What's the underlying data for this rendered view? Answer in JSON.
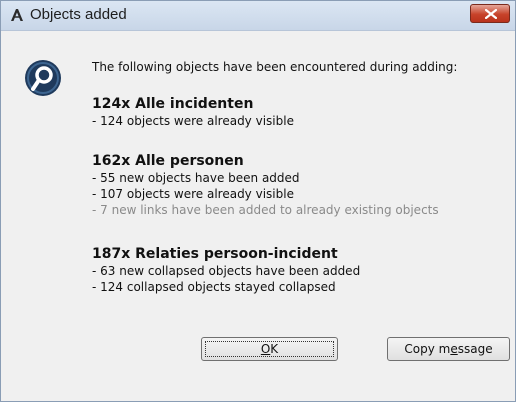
{
  "window": {
    "title": "Objects added"
  },
  "dialog": {
    "intro": "The following objects have been encountered during adding:",
    "groups": [
      {
        "title": "124x Alle incidenten",
        "lines": [
          {
            "text": "- 124 objects were already visible",
            "dim": false
          }
        ]
      },
      {
        "title": "162x Alle personen",
        "lines": [
          {
            "text": "- 55 new objects have been added",
            "dim": false
          },
          {
            "text": "- 107 objects were already visible",
            "dim": false
          },
          {
            "text": "- 7 new links have been added to already existing objects",
            "dim": true
          }
        ]
      },
      {
        "title": "187x Relaties persoon-incident",
        "lines": [
          {
            "text": "- 63 new collapsed objects have been added",
            "dim": false
          },
          {
            "text": "- 124 collapsed objects stayed collapsed",
            "dim": false
          }
        ]
      }
    ]
  },
  "buttons": {
    "ok": {
      "before": "",
      "mnemonic": "O",
      "after": "K"
    },
    "copy": {
      "before": "Copy m",
      "mnemonic": "e",
      "after": "ssage"
    }
  },
  "icons": {
    "title_icon": "app-logo-icon",
    "info_icon": "magnifier-info-icon",
    "close_icon": "close-icon"
  },
  "colors": {
    "close_button": "#c7432a",
    "dim_text": "#8a8a8a"
  }
}
